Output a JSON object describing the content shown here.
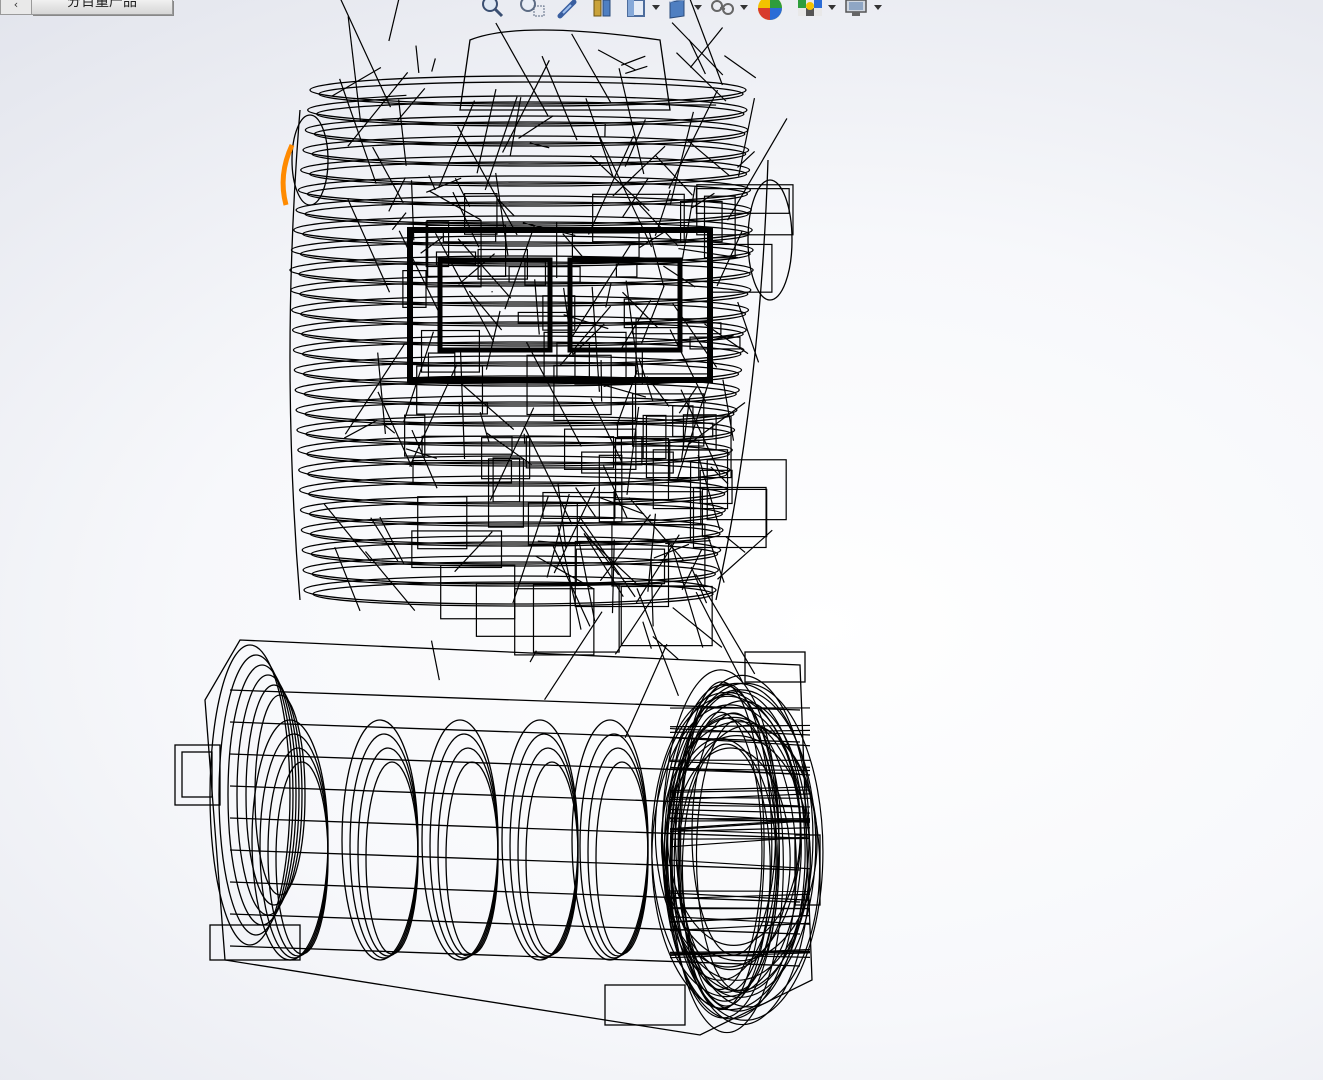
{
  "window": {
    "document_tab_label": "分百量产品",
    "collapse_tab_glyph": "‹"
  },
  "heads_up_toolbar": {
    "tools": [
      {
        "icon": "zoom-to-fit-icon",
        "has_dropdown": false
      },
      {
        "icon": "zoom-to-area-icon",
        "has_dropdown": false
      },
      {
        "icon": "previous-view-icon",
        "has_dropdown": false
      },
      {
        "icon": "section-view-icon",
        "has_dropdown": false
      },
      {
        "icon": "view-orientation-icon",
        "has_dropdown": true
      },
      {
        "icon": "display-style-icon",
        "has_dropdown": true
      },
      {
        "icon": "hide-show-items-icon",
        "has_dropdown": true
      },
      {
        "icon": "edit-appearance-icon",
        "has_dropdown": false
      },
      {
        "icon": "apply-scene-icon",
        "has_dropdown": true
      },
      {
        "icon": "view-settings-icon",
        "has_dropdown": true
      }
    ]
  },
  "model": {
    "display_mode": "wireframe",
    "highlight_color": "#ff8a00",
    "line_color": "#000000"
  }
}
